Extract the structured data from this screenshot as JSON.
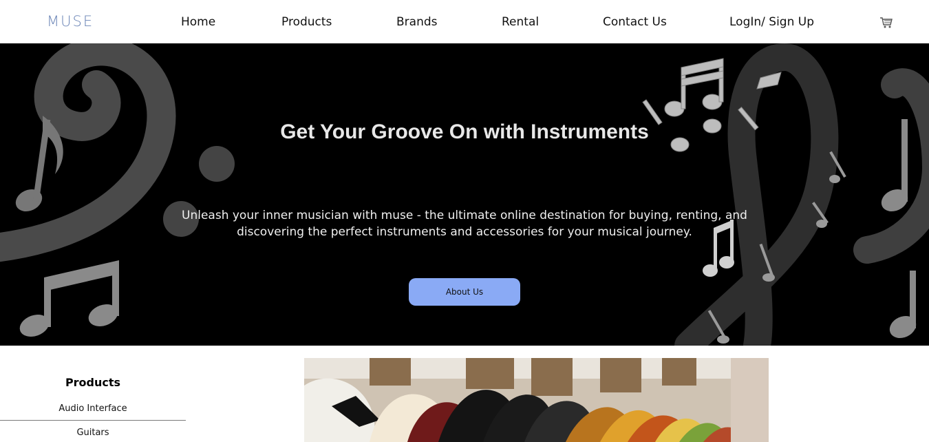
{
  "brand": {
    "logo": "MUSE"
  },
  "nav": {
    "items": [
      {
        "label": "Home"
      },
      {
        "label": "Products"
      },
      {
        "label": "Brands"
      },
      {
        "label": "Rental"
      },
      {
        "label": "Contact Us"
      },
      {
        "label": "LogIn/ Sign Up"
      }
    ],
    "cart_icon": "shopping-cart-icon"
  },
  "hero": {
    "title": "Get Your Groove On with Instruments",
    "subtitle": "Unleash your inner musician with muse - the ultimate online destination for buying, renting, and discovering the perfect instruments and accessories for your musical journey.",
    "button_label": "About Us",
    "decor_icons": [
      "bass-clef-icon",
      "eighth-note-icon",
      "beamed-notes-icon",
      "treble-clef-icon",
      "sixteenth-note-icon"
    ]
  },
  "sidebar": {
    "heading": "Products",
    "categories": [
      {
        "label": "Audio Interface"
      },
      {
        "label": "Guitars"
      }
    ]
  },
  "colors": {
    "accent": "#8aaaf5",
    "logo": "#6a84b6",
    "hero_bg": "#000000"
  }
}
